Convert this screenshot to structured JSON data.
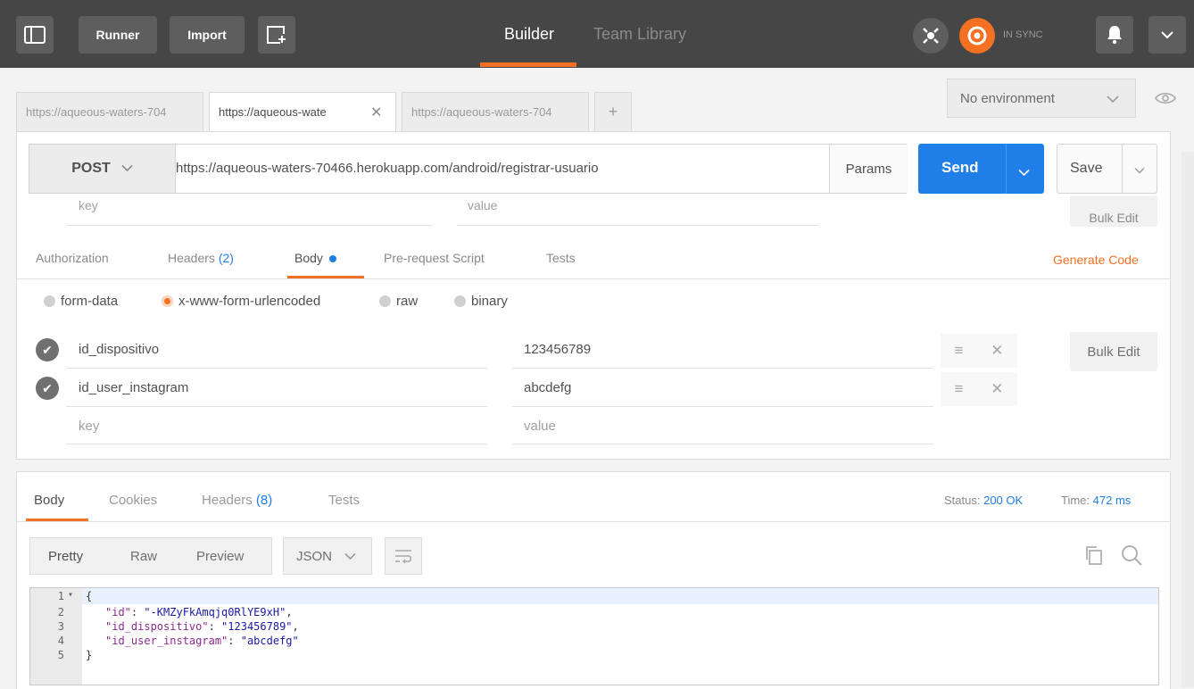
{
  "topbar": {
    "runner": "Runner",
    "import": "Import",
    "builder": "Builder",
    "team_library": "Team Library",
    "sync_status": "IN SYNC"
  },
  "tabs": [
    {
      "label": "https://aqueous-waters-704"
    },
    {
      "label": "https://aqueous-wate"
    },
    {
      "label": "https://aqueous-waters-704"
    }
  ],
  "environment": "No environment",
  "request": {
    "method": "POST",
    "url": "https://aqueous-waters-70466.herokuapp.com/android/registrar-usuario",
    "params": "Params",
    "send": "Send",
    "save": "Save"
  },
  "hidden_row": {
    "key": "key",
    "value": "value",
    "bulk": "Bulk Edit"
  },
  "subtabs": {
    "authorization": "Authorization",
    "headers": "Headers",
    "headers_count": "(2)",
    "body": "Body",
    "prerequest": "Pre-request Script",
    "tests": "Tests",
    "generate_code": "Generate Code"
  },
  "body_types": [
    "form-data",
    "x-www-form-urlencoded",
    "raw",
    "binary"
  ],
  "params": [
    {
      "key": "id_dispositivo",
      "value": "123456789"
    },
    {
      "key": "id_user_instagram",
      "value": "abcdefg"
    }
  ],
  "new_param": {
    "key": "key",
    "value": "value"
  },
  "bulk_edit": "Bulk Edit",
  "response": {
    "tabs": {
      "body": "Body",
      "cookies": "Cookies",
      "headers": "Headers",
      "headers_count": "(8)",
      "tests": "Tests"
    },
    "status_label": "Status:",
    "status_value": "200 OK",
    "time_label": "Time:",
    "time_value": "472 ms",
    "formats": {
      "pretty": "Pretty",
      "raw": "Raw",
      "preview": "Preview",
      "json": "JSON"
    }
  },
  "code_lines": [
    {
      "n": "1",
      "text": "{"
    },
    {
      "n": "2",
      "key": "\"id\"",
      "val": "\"-KMZyFkAmqjq0RlYE9xH\"",
      "tail": ","
    },
    {
      "n": "3",
      "key": "\"id_dispositivo\"",
      "val": "\"123456789\"",
      "tail": ","
    },
    {
      "n": "4",
      "key": "\"id_user_instagram\"",
      "val": "\"abcdefg\"",
      "tail": ""
    },
    {
      "n": "5",
      "text": "}"
    }
  ],
  "colors": {
    "accent": "#f47023",
    "send": "#1f7ee8",
    "link": "#1f7ee8",
    "topbar": "#464646"
  }
}
